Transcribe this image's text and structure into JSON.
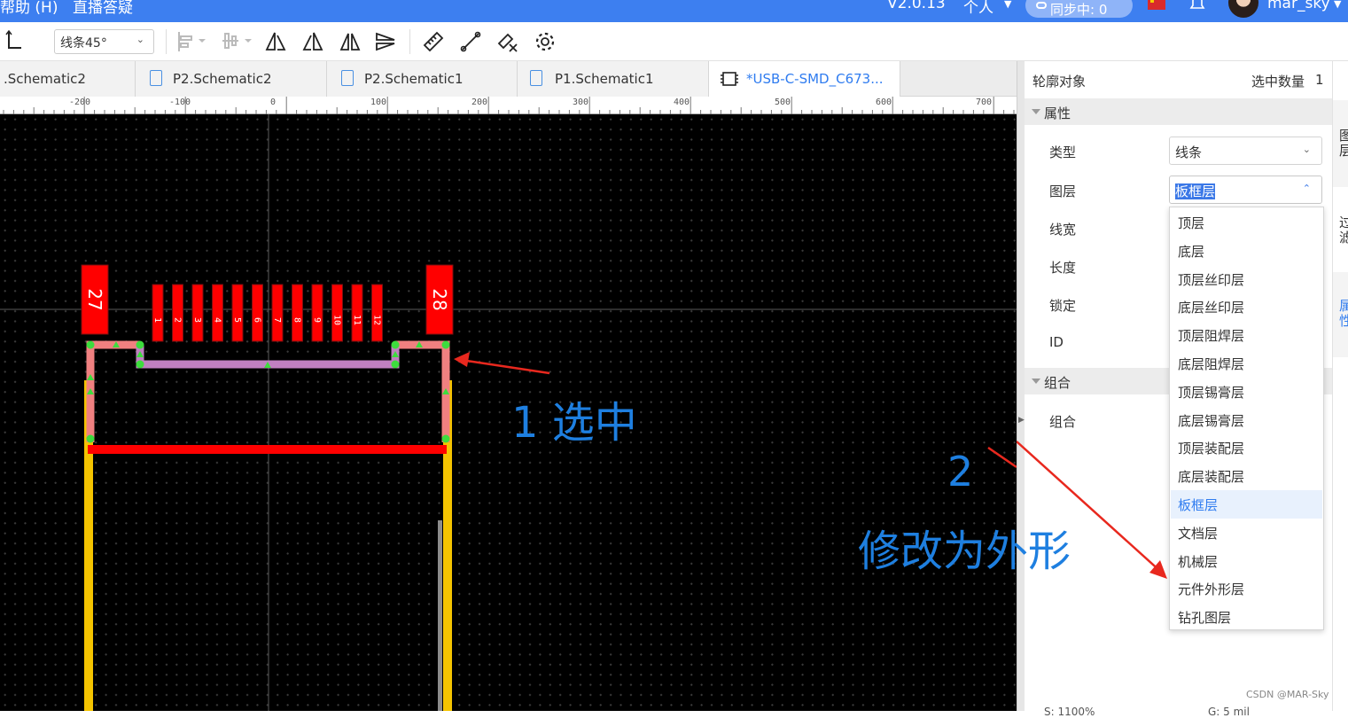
{
  "topbar": {
    "menu_help": "帮助 (H)",
    "menu_live": "直播答疑",
    "version": "V2.0.13",
    "personal": "个人",
    "sync_status": "同步中: 0",
    "username": "mar_sky"
  },
  "toolbar": {
    "line_mode": "线条45°"
  },
  "tabs": [
    {
      "label": ".Schematic2"
    },
    {
      "label": "P2.Schematic2"
    },
    {
      "label": "P2.Schematic1"
    },
    {
      "label": "P1.Schematic1"
    },
    {
      "label": "*USB-C-SMD_C673..."
    }
  ],
  "ruler": {
    "ticks": [
      "-200",
      "-100",
      "0",
      "100",
      "200",
      "300",
      "400",
      "500",
      "600",
      "700"
    ]
  },
  "canvas": {
    "pads": [
      "27",
      "28"
    ],
    "pin_numbers": [
      "1",
      "2",
      "3",
      "4",
      "5",
      "6",
      "7",
      "8",
      "9",
      "10",
      "11",
      "12"
    ]
  },
  "annotations": {
    "step1": "1 选中",
    "step2_num": "2",
    "step2_text": "修改为外形"
  },
  "panel": {
    "object_label": "轮廓对象",
    "selection_count_label": "选中数量",
    "selection_count": "1",
    "section_props": "属性",
    "type_label": "类型",
    "type_value": "线条",
    "layer_label": "图层",
    "layer_value": "板框层",
    "width_label": "线宽",
    "length_label": "长度",
    "lock_label": "锁定",
    "id_label": "ID",
    "section_group": "组合",
    "group_label": "组合"
  },
  "layer_options": [
    "顶层",
    "底层",
    "顶层丝印层",
    "底层丝印层",
    "顶层阻焊层",
    "底层阻焊层",
    "顶层锡膏层",
    "底层锡膏层",
    "顶层装配层",
    "底层装配层",
    "板框层",
    "文档层",
    "机械层",
    "元件外形层",
    "钻孔图层"
  ],
  "selected_layer_index": 10,
  "strip": {
    "tab1": "图层",
    "tab2": "过滤",
    "tab3": "属性"
  },
  "watermark": "CSDN @MAR-Sky",
  "statusbar": {
    "zoom": "S: 1100%",
    "grid": "G: 5 mil"
  },
  "colors": {
    "accent": "#3d7ff0",
    "annotation": "#1e7fe0",
    "pad_red": "#ff0000",
    "outline_yellow": "#f5c400",
    "outline_pink": "#f08080",
    "outline_purple": "#c080c0"
  }
}
